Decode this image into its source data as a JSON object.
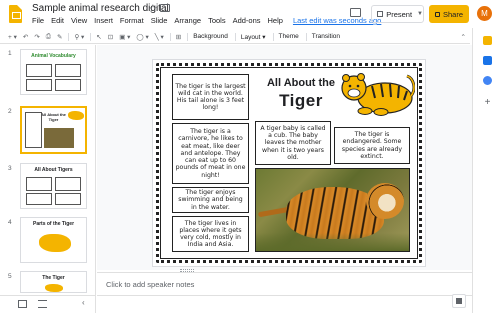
{
  "app": {
    "doc_title": "Sample animal research digital",
    "menu": [
      "File",
      "Edit",
      "View",
      "Insert",
      "Format",
      "Slide",
      "Arrange",
      "Tools",
      "Add-ons",
      "Help"
    ],
    "last_edit": "Last edit was seconds ago",
    "present_label": "Present",
    "share_label": "Share",
    "avatar_letter": "M"
  },
  "toolbar": {
    "background_label": "Background",
    "layout_label": "Layout",
    "theme_label": "Theme",
    "transition_label": "Transition"
  },
  "filmstrip": {
    "slides": [
      {
        "number": "1",
        "title": "Animal Vocabulary"
      },
      {
        "number": "2",
        "title": "All About the Tiger"
      },
      {
        "number": "3",
        "title": "All About Tigers"
      },
      {
        "number": "4",
        "title": "Parts of the Tiger"
      },
      {
        "number": "5",
        "title": "The Tiger"
      }
    ]
  },
  "slide": {
    "heading_line1": "All About the",
    "heading_line2": "Tiger",
    "facts": {
      "largest": "The tiger is the largest wild cat in the world. His tail alone is 3 feet long!",
      "carnivore": "The tiger is a carnivore, he likes to eat meat, like deer and antelope. They can eat up to 60 pounds of meat in one night!",
      "swimming": "The tiger enjoys swimming and being in the water.",
      "habitat": "The tiger lives in places where it gets very cold, mostly in India and Asia.",
      "cub": "A tiger baby is called a cub. The baby leaves the mother when it is two years old.",
      "endangered": "The tiger is endangered. Some species are already extinct."
    }
  },
  "notes": {
    "placeholder": "Click to add speaker notes"
  },
  "colors": {
    "brand_yellow": "#f4b400",
    "link_blue": "#1a73e8",
    "avatar_orange": "#e8710a"
  }
}
